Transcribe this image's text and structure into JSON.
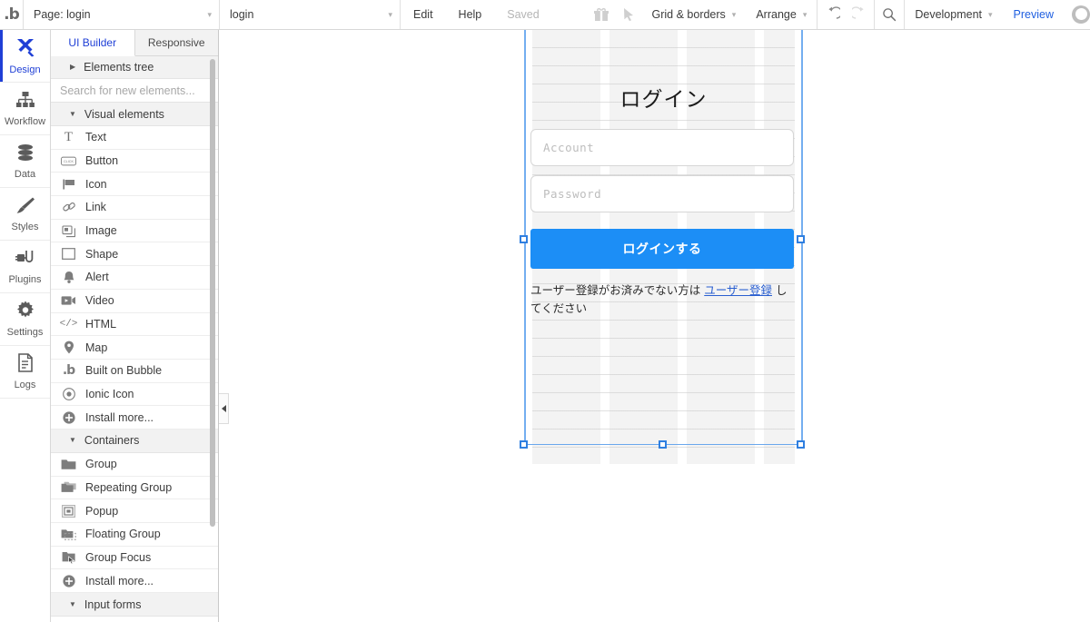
{
  "topbar": {
    "logo": "bubble-logo",
    "page_selector": {
      "value": "Page: login",
      "caret": "▾"
    },
    "element_selector": {
      "value": "login",
      "caret": "▾"
    },
    "menus": [
      {
        "label": "Edit",
        "state": "normal"
      },
      {
        "label": "Help",
        "state": "normal"
      },
      {
        "label": "Saved",
        "state": "muted"
      }
    ],
    "gift_icon": "gift-icon",
    "pointer_icon": "cursor-arrow-icon",
    "grid_borders": {
      "label": "Grid & borders",
      "caret": "▾"
    },
    "arrange": {
      "label": "Arrange",
      "caret": "▾"
    },
    "undo": "undo-icon",
    "redo": "redo-icon",
    "search_icon": "search-icon",
    "version": {
      "label": "Development",
      "caret": "▾"
    },
    "preview": "Preview",
    "avatar": "user-avatar"
  },
  "rail": {
    "items": [
      {
        "label": "Design",
        "icon": "design-icon",
        "active": true
      },
      {
        "label": "Workflow",
        "icon": "workflow-icon",
        "active": false
      },
      {
        "label": "Data",
        "icon": "database-icon",
        "active": false
      },
      {
        "label": "Styles",
        "icon": "brush-icon",
        "active": false
      },
      {
        "label": "Plugins",
        "icon": "plug-icon",
        "active": false
      },
      {
        "label": "Settings",
        "icon": "gear-icon",
        "active": false
      },
      {
        "label": "Logs",
        "icon": "document-icon",
        "active": false
      }
    ]
  },
  "panel": {
    "tabs": [
      {
        "label": "UI Builder",
        "active": true
      },
      {
        "label": "Responsive",
        "active": false
      }
    ],
    "elements_tree": {
      "label": "Elements tree",
      "triangle": "▶"
    },
    "search": {
      "placeholder": "Search for new elements...",
      "value": ""
    },
    "sections": [
      {
        "title": "Visual elements",
        "triangle": "▼",
        "items": [
          {
            "label": "Text",
            "icon": "text-t-icon"
          },
          {
            "label": "Button",
            "icon": "button-click-icon"
          },
          {
            "label": "Icon",
            "icon": "flag-icon"
          },
          {
            "label": "Link",
            "icon": "link-chain-icon"
          },
          {
            "label": "Image",
            "icon": "image-icon"
          },
          {
            "label": "Shape",
            "icon": "rectangle-shape-icon"
          },
          {
            "label": "Alert",
            "icon": "bell-alert-icon"
          },
          {
            "label": "Video",
            "icon": "video-camera-icon"
          },
          {
            "label": "HTML",
            "icon": "code-brackets-icon"
          },
          {
            "label": "Map",
            "icon": "map-pin-icon"
          },
          {
            "label": "Built on Bubble",
            "icon": "bubble-b-icon"
          },
          {
            "label": "Ionic Icon",
            "icon": "ionic-circle-icon"
          },
          {
            "label": "Install more...",
            "icon": "plus-circle-icon"
          }
        ]
      },
      {
        "title": "Containers",
        "triangle": "▼",
        "items": [
          {
            "label": "Group",
            "icon": "folder-icon"
          },
          {
            "label": "Repeating Group",
            "icon": "repeating-folder-icon"
          },
          {
            "label": "Popup",
            "icon": "popup-window-icon"
          },
          {
            "label": "Floating Group",
            "icon": "floating-folder-icon"
          },
          {
            "label": "Group Focus",
            "icon": "group-focus-icon"
          },
          {
            "label": "Install more...",
            "icon": "plus-circle-icon"
          }
        ]
      },
      {
        "title": "Input forms",
        "triangle": "▼",
        "items": []
      }
    ]
  },
  "canvas": {
    "collapse_handle": "collapse-left-icon",
    "selection": {
      "handles": 4
    },
    "login_form": {
      "title": "ログイン",
      "account_field": {
        "placeholder": "Account",
        "value": ""
      },
      "password_field": {
        "placeholder": "Password",
        "value": ""
      },
      "submit_label": "ログインする",
      "signup_prefix": "ユーザー登録がお済みでない方は ",
      "signup_link": "ユーザー登録",
      "signup_suffix": " してください"
    }
  },
  "colors": {
    "accent_blue": "#1c8ef6",
    "brand_blue": "#1f3fd6",
    "link_blue": "#2a5fd0",
    "selection_blue": "#2f7fe0",
    "panel_gray": "#f2f2f2"
  }
}
